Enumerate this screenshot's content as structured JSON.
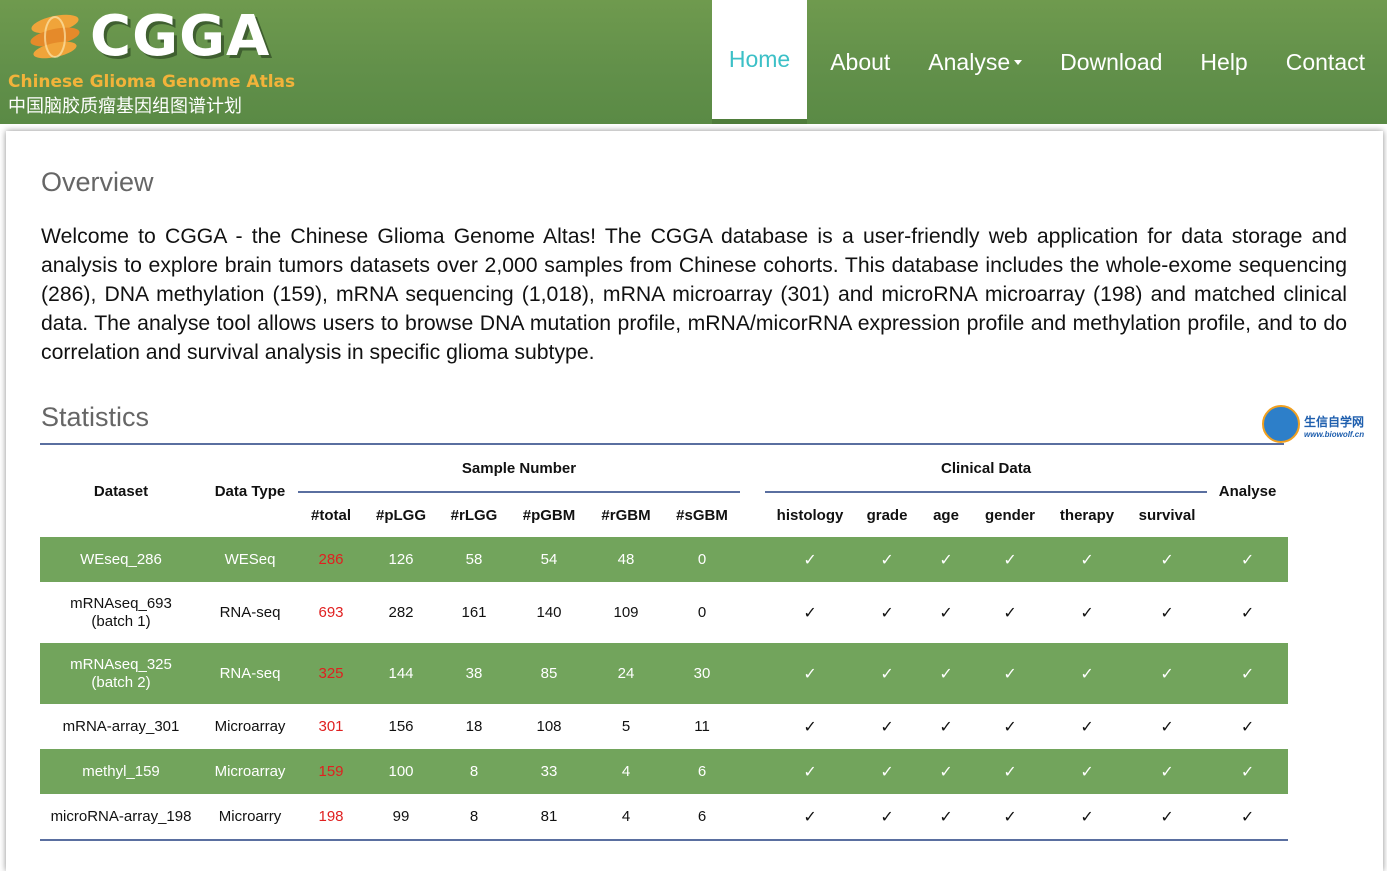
{
  "brand": {
    "logo_text": "CGGA",
    "english_name": "Chinese Glioma Genome Atlas",
    "chinese_name": "中国脑胶质瘤基因组图谱计划"
  },
  "nav": {
    "home": "Home",
    "about": "About",
    "analyse": "Analyse",
    "download": "Download",
    "help": "Help",
    "contact": "Contact"
  },
  "overview": {
    "title": "Overview",
    "text": "Welcome to CGGA - the Chinese Glioma Genome Altas! The CGGA database is a user-friendly web application for data storage and analysis to explore brain tumors datasets over 2,000 samples from Chinese cohorts. This database includes the whole-exome sequencing (286), DNA methylation (159), mRNA sequencing (1,018), mRNA microarray (301) and microRNA microarray (198) and matched clinical data. The analyse tool allows users to browse DNA mutation profile, mRNA/micorRNA expression profile and methylation profile, and to do correlation and survival analysis in specific glioma subtype."
  },
  "statistics": {
    "title": "Statistics",
    "headers": {
      "dataset": "Dataset",
      "data_type": "Data Type",
      "sample_number": "Sample Number",
      "clinical_data": "Clinical Data",
      "analyse": "Analyse",
      "sample_cols": [
        "#total",
        "#pLGG",
        "#rLGG",
        "#pGBM",
        "#rGBM",
        "#sGBM"
      ],
      "clinical_cols": [
        "histology",
        "grade",
        "age",
        "gender",
        "therapy",
        "survival"
      ]
    },
    "rows": [
      {
        "dataset": "WEseq_286",
        "type": "WESeq",
        "counts": [
          "286",
          "126",
          "58",
          "54",
          "48",
          "0"
        ]
      },
      {
        "dataset": "mRNAseq_693\n(batch 1)",
        "type": "RNA-seq",
        "counts": [
          "693",
          "282",
          "161",
          "140",
          "109",
          "0"
        ]
      },
      {
        "dataset": "mRNAseq_325\n(batch 2)",
        "type": "RNA-seq",
        "counts": [
          "325",
          "144",
          "38",
          "85",
          "24",
          "30"
        ]
      },
      {
        "dataset": "mRNA-array_301",
        "type": "Microarray",
        "counts": [
          "301",
          "156",
          "18",
          "108",
          "5",
          "11"
        ]
      },
      {
        "dataset": "methyl_159",
        "type": "Microarray",
        "counts": [
          "159",
          "100",
          "8",
          "33",
          "4",
          "6"
        ]
      },
      {
        "dataset": "microRNA-array_198",
        "type": "Microarry",
        "counts": [
          "198",
          "99",
          "8",
          "81",
          "4",
          "6"
        ]
      }
    ],
    "check_mark": "✓"
  },
  "watermark": {
    "title": "生信自学网",
    "url": "www.biowolf.cn"
  }
}
